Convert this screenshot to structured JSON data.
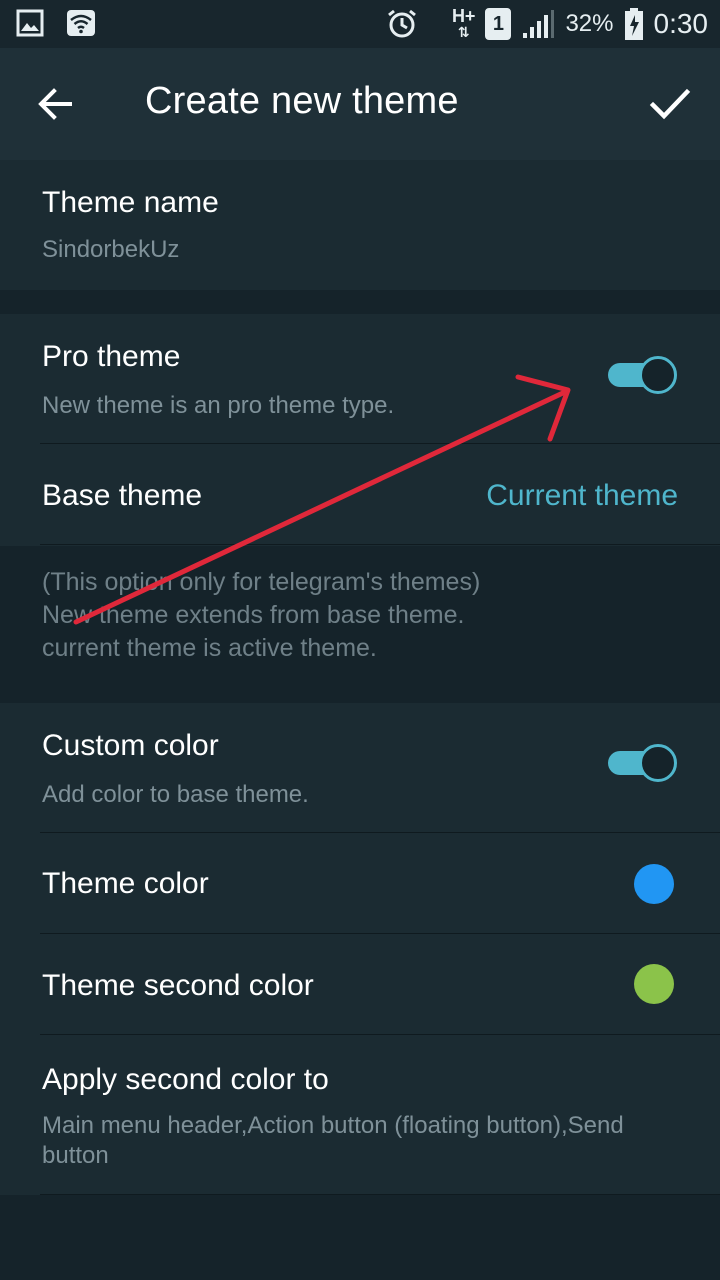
{
  "status_bar": {
    "icons": [
      "image-icon",
      "wifi-icon",
      "alarm-icon",
      "hplus-icon",
      "sim-icon",
      "signal-icon",
      "battery-icon"
    ],
    "network_label": "H+",
    "sim_number": "1",
    "battery_percent": "32%",
    "time": "0:30"
  },
  "app_bar": {
    "title": "Create new theme",
    "back_icon": "arrow-left-icon",
    "confirm_icon": "check-icon"
  },
  "settings": {
    "theme_name": {
      "label": "Theme name",
      "value": "SindorbekUz"
    },
    "pro_theme": {
      "label": "Pro theme",
      "description": "New theme is an pro theme type.",
      "enabled": true
    },
    "base_theme": {
      "label": "Base theme",
      "value": "Current theme"
    },
    "info_lines": [
      "(This option only for telegram's themes)",
      "New theme extends from base theme.",
      "current theme is active theme."
    ],
    "custom_color": {
      "label": "Custom color",
      "description": "Add color to base theme.",
      "enabled": true
    },
    "theme_color": {
      "label": "Theme color",
      "color": "#2196f3"
    },
    "theme_second_color": {
      "label": "Theme second color",
      "color": "#8bc34a"
    },
    "apply_second_color": {
      "label": "Apply second color to",
      "value_line1": "Main menu header,Action button (floating button),Send",
      "value_line2": "button"
    }
  },
  "colors": {
    "accent": "#4fb6cc",
    "background": "#15232a",
    "annotation_arrow": "#e0283a"
  }
}
